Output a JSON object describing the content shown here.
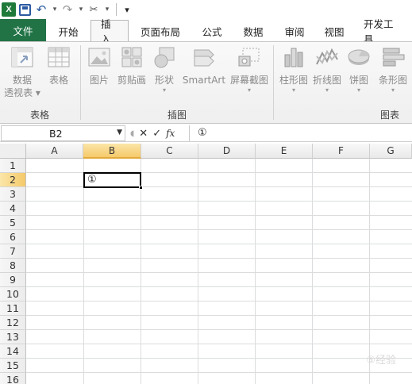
{
  "qat": {
    "app_icon_letter": "X",
    "undo_glyph": "↶",
    "redo_glyph": "↷",
    "tools_glyph": "✂",
    "customize_glyph": "▾"
  },
  "tabs": [
    {
      "label": "文件",
      "kind": "file"
    },
    {
      "label": "开始",
      "kind": "normal"
    },
    {
      "label": "插入",
      "kind": "active"
    },
    {
      "label": "页面布局",
      "kind": "normal"
    },
    {
      "label": "公式",
      "kind": "normal"
    },
    {
      "label": "数据",
      "kind": "normal"
    },
    {
      "label": "审阅",
      "kind": "normal"
    },
    {
      "label": "视图",
      "kind": "normal"
    },
    {
      "label": "开发工具",
      "kind": "normal"
    }
  ],
  "ribbon": {
    "groups": {
      "tables": {
        "label": "表格",
        "pivot_label_1": "数据",
        "pivot_label_2": "透视表",
        "table_label": "表格"
      },
      "illustrations": {
        "label": "插图",
        "picture_label": "图片",
        "clipart_label": "剪贴画",
        "shapes_label": "形状",
        "smartart_label": "SmartArt",
        "screenshot_label": "屏幕截图"
      },
      "charts": {
        "label": "图表",
        "column_label": "柱形图",
        "line_label": "折线图",
        "pie_label": "饼图",
        "bar_label": "条形图"
      }
    }
  },
  "formula_bar": {
    "name_box": "B2",
    "cancel_glyph": "✕",
    "enter_glyph": "✓",
    "fx_label": "fx",
    "content": "①"
  },
  "sheet": {
    "columns": [
      "A",
      "B",
      "C",
      "D",
      "E",
      "F",
      "G"
    ],
    "selected_column": "B",
    "rows": [
      "1",
      "2",
      "3",
      "4",
      "5",
      "6",
      "7",
      "8",
      "9",
      "10",
      "11",
      "12",
      "13",
      "14",
      "15",
      "16"
    ],
    "selected_row": "2",
    "active_cell_value": "①"
  },
  "watermark": "⑤经验"
}
